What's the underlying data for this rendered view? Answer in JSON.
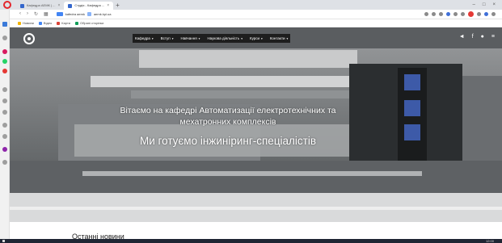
{
  "browser": {
    "tabs": [
      {
        "label": "Кафедра АЕМК | ..."
      },
      {
        "label": "Студія - Кафедра ..."
      }
    ],
    "new_tab": "+",
    "window_controls": [
      "–",
      "□",
      "×"
    ],
    "address": {
      "site_label": "kafedra aemk",
      "url": "aemk.kpi.ua"
    },
    "bookmarks": [
      {
        "label": "Новини",
        "color": "#f4b400"
      },
      {
        "label": "Відео",
        "color": "#4285f4"
      },
      {
        "label": "Карти",
        "color": "#db4437"
      },
      {
        "label": "Обрані сторінки",
        "color": "#0f9d58"
      }
    ]
  },
  "site": {
    "menu": [
      {
        "label": "Кафедра"
      },
      {
        "label": "Вступ"
      },
      {
        "label": "Навчання"
      },
      {
        "label": "Наукова діяльність"
      },
      {
        "label": "Курси"
      },
      {
        "label": "Контакти"
      }
    ],
    "menu_caret": "▾",
    "hero_icons": [
      "◄",
      "f",
      "●",
      "≡"
    ],
    "hero_title": "Вітаємо на кафедрі Автоматизації електротехнічних та мехатронних комплексів",
    "hero_subtitle": "Ми готуємо інжиніринг-спеціалістів",
    "news_heading": "Останні новини"
  },
  "taskbar": {
    "time": "12:00"
  },
  "colors": {
    "menu_bg": "#1e1e1e",
    "opera_red": "#e3252c",
    "taskbar_bg": "#1f2533"
  }
}
